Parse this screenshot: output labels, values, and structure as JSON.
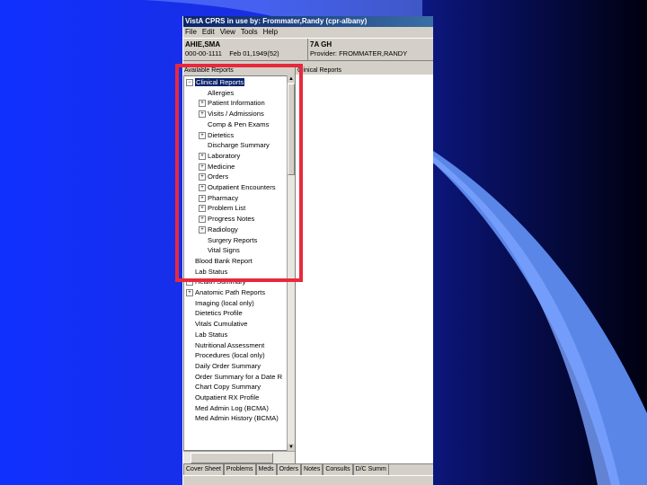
{
  "window": {
    "title": "VistA CPRS in use by: Frommater,Randy  (cpr-albany)"
  },
  "menu": [
    "File",
    "Edit",
    "View",
    "Tools",
    "Help"
  ],
  "patient": {
    "name": "AHIE,SMA",
    "ssn": "000-00-1111",
    "dob": "Feb 01,1949(52)",
    "location": "7A GH",
    "provider": "Provider:  FROMMATER,RANDY"
  },
  "left_pane": {
    "header": "Available Reports"
  },
  "right_pane": {
    "header": "Clinical Reports"
  },
  "tree": [
    {
      "label": "Clinical Reports",
      "expander": "−",
      "indent": 0,
      "selected": true
    },
    {
      "label": "Allergies",
      "expander": "",
      "indent": 1
    },
    {
      "label": "Patient Information",
      "expander": "+",
      "indent": 1
    },
    {
      "label": "Visits / Admissions",
      "expander": "+",
      "indent": 1
    },
    {
      "label": "Comp & Pen Exams",
      "expander": "",
      "indent": 1
    },
    {
      "label": "Dietetics",
      "expander": "+",
      "indent": 1
    },
    {
      "label": "Discharge Summary",
      "expander": "",
      "indent": 1
    },
    {
      "label": "Laboratory",
      "expander": "+",
      "indent": 1
    },
    {
      "label": "Medicine",
      "expander": "+",
      "indent": 1
    },
    {
      "label": "Orders",
      "expander": "+",
      "indent": 1
    },
    {
      "label": "Outpatient Encounters",
      "expander": "+",
      "indent": 1
    },
    {
      "label": "Pharmacy",
      "expander": "+",
      "indent": 1
    },
    {
      "label": "Problem List",
      "expander": "+",
      "indent": 1
    },
    {
      "label": "Progress Notes",
      "expander": "+",
      "indent": 1
    },
    {
      "label": "Radiology",
      "expander": "+",
      "indent": 1
    },
    {
      "label": "Surgery Reports",
      "expander": "",
      "indent": 1
    },
    {
      "label": "Vital Signs",
      "expander": "",
      "indent": 1
    },
    {
      "label": "Blood Bank Report",
      "expander": "",
      "indent": 0
    },
    {
      "label": "Lab Status",
      "expander": "",
      "indent": 0
    },
    {
      "label": "Health Summary",
      "expander": "+",
      "indent": 0
    },
    {
      "label": "Anatomic Path Reports",
      "expander": "+",
      "indent": 0
    },
    {
      "label": "Imaging (local only)",
      "expander": "",
      "indent": 0
    },
    {
      "label": "Dietetics Profile",
      "expander": "",
      "indent": 0
    },
    {
      "label": "Vitals Cumulative",
      "expander": "",
      "indent": 0
    },
    {
      "label": "Lab Status",
      "expander": "",
      "indent": 0
    },
    {
      "label": "Nutritional Assessment",
      "expander": "",
      "indent": 0
    },
    {
      "label": "Procedures (local only)",
      "expander": "",
      "indent": 0
    },
    {
      "label": "Daily Order Summary",
      "expander": "",
      "indent": 0
    },
    {
      "label": "Order Summary for a Date R",
      "expander": "",
      "indent": 0
    },
    {
      "label": "Chart Copy Summary",
      "expander": "",
      "indent": 0
    },
    {
      "label": "Outpatient RX Profile",
      "expander": "",
      "indent": 0
    },
    {
      "label": "Med Admin Log (BCMA)",
      "expander": "",
      "indent": 0
    },
    {
      "label": "Med Admin History (BCMA)",
      "expander": "",
      "indent": 0
    }
  ],
  "tabs": [
    "Cover Sheet",
    "Problems",
    "Meds",
    "Orders",
    "Notes",
    "Consults",
    "D/C Summ"
  ],
  "colors": {
    "highlight": "#e8293c",
    "selection": "#0a246a"
  }
}
